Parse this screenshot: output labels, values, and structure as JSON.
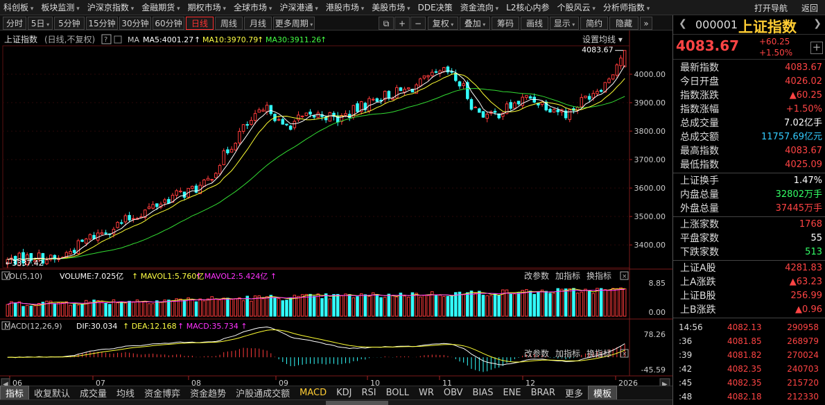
{
  "menu": {
    "items": [
      {
        "label": "科创板",
        "dd": true
      },
      {
        "label": "板块监测",
        "dd": true
      },
      {
        "label": "沪深京指数",
        "dd": true
      },
      {
        "label": "金融期货",
        "dd": true
      },
      {
        "label": "期权市场",
        "dd": true
      },
      {
        "label": "全球市场",
        "dd": true
      },
      {
        "label": "沪深港通",
        "dd": true
      },
      {
        "label": "港股市场",
        "dd": true
      },
      {
        "label": "美股市场",
        "dd": true
      },
      {
        "label": "DDE决策",
        "dd": false
      },
      {
        "label": "资金流向",
        "dd": true
      },
      {
        "label": "L2核心内参",
        "dd": false
      },
      {
        "label": "个股风云",
        "dd": true
      },
      {
        "label": "分析师指数",
        "dd": true
      }
    ],
    "right": [
      "打开导航",
      "返回"
    ]
  },
  "toolbar": {
    "periods": [
      "分时",
      "5日",
      "5分钟",
      "15分钟",
      "30分钟",
      "60分钟",
      "日线",
      "周线",
      "月线",
      "更多周期"
    ],
    "active_period": "日线",
    "tools": [
      "复权",
      "叠加",
      "筹码",
      "画线",
      "显示",
      "简约",
      "隐藏"
    ],
    "icons": [
      "⧉",
      "+",
      "−"
    ]
  },
  "chart": {
    "title": "上证指数",
    "subtitle": "(日线,不复权)",
    "help": "?",
    "ma_label": "MA",
    "ma5": "MA5:4001.27",
    "ma10": "MA10:3970.79",
    "ma30": "MA30:3911.26",
    "arrow": "↑",
    "settings": "设置均线 ▾",
    "price_labels": [
      "4000.00",
      "3900.00",
      "3800.00",
      "3700.00",
      "3600.00",
      "3500.00",
      "3400.00"
    ],
    "high_marker": "4083.67",
    "low_marker": "3337.42",
    "vol_title": "VOL(5,10)",
    "vol_val": "VOLUME:7.025亿",
    "vol_mavol1": "MAVOL1:5.760亿",
    "vol_mavol2": "MAVOL2:5.424亿",
    "vol_labels": [
      "8.85",
      "0.00"
    ],
    "macd_title": "MACD(12,26,9)",
    "macd_dif": "DIF:30.034",
    "macd_dea": "DEA:12.168",
    "macd_val": "MACD:35.734",
    "macd_labels": [
      "78.26",
      "-45.59"
    ],
    "actions": [
      "改参数",
      "加指标",
      "换指标"
    ],
    "months": [
      "06",
      "07",
      "08",
      "09",
      "10",
      "11",
      "12",
      "2026"
    ]
  },
  "chart_data": {
    "type": "candlestick",
    "ylim": [
      3320,
      4100
    ],
    "start": 3335,
    "end": 4083.67,
    "n": 158,
    "waypoints": [
      [
        0,
        3345
      ],
      [
        10,
        3360
      ],
      [
        18,
        3345
      ],
      [
        20,
        3360
      ],
      [
        30,
        3425
      ],
      [
        40,
        3470
      ],
      [
        50,
        3520
      ],
      [
        60,
        3570
      ],
      [
        65,
        3585
      ],
      [
        72,
        3610
      ],
      [
        78,
        3700
      ],
      [
        85,
        3800
      ],
      [
        92,
        3860
      ],
      [
        96,
        3880
      ],
      [
        100,
        3810
      ],
      [
        106,
        3840
      ],
      [
        115,
        3860
      ],
      [
        120,
        3840
      ],
      [
        128,
        3880
      ],
      [
        135,
        3920
      ],
      [
        140,
        3930
      ],
      [
        146,
        3945
      ],
      [
        154,
        3985
      ],
      [
        160,
        4010
      ],
      [
        166,
        3955
      ],
      [
        170,
        3880
      ],
      [
        176,
        3850
      ],
      [
        184,
        3890
      ],
      [
        190,
        3920
      ],
      [
        197,
        3890
      ],
      [
        204,
        3860
      ],
      [
        212,
        3930
      ],
      [
        218,
        3970
      ],
      [
        225,
        4083.67
      ]
    ],
    "vol_max": 8.85,
    "macd_range": [
      -45.59,
      78.26
    ]
  },
  "side": {
    "code": "000001",
    "name": "上证指数",
    "price": "4083.67",
    "change": "+60.25",
    "pct": "+1.50%",
    "rows1": [
      [
        "最新指数",
        "4083.67",
        "r"
      ],
      [
        "今日开盘",
        "4026.02",
        "r"
      ],
      [
        "指数涨跌",
        "▲60.25",
        "r"
      ],
      [
        "指数涨幅",
        "+1.50%",
        "r"
      ],
      [
        "总成交量",
        "7.02亿手",
        "w"
      ],
      [
        "总成交额",
        "11757.69亿元",
        "c"
      ],
      [
        "最高指数",
        "4083.67",
        "r"
      ],
      [
        "最低指数",
        "4025.09",
        "r"
      ]
    ],
    "rows2": [
      [
        "上证换手",
        "1.47%",
        "w"
      ],
      [
        "内盘总量",
        "32802万手",
        "g"
      ],
      [
        "外盘总量",
        "37445万手",
        "r"
      ]
    ],
    "rows3": [
      [
        "上涨家数",
        "1768",
        "r"
      ],
      [
        "平盘家数",
        "55",
        "w"
      ],
      [
        "下跌家数",
        "513",
        "g"
      ]
    ],
    "rows4": [
      [
        "上证A股",
        "4281.83",
        "r"
      ],
      [
        "上A涨跌",
        "▲63.23",
        "r"
      ],
      [
        "上证B股",
        "256.99",
        "r"
      ],
      [
        "上B涨跌",
        "▲0.96",
        "r"
      ]
    ],
    "ticks": [
      [
        "14:56",
        "4082.13",
        "290958"
      ],
      [
        ":36",
        "4081.85",
        "268979"
      ],
      [
        ":39",
        "4081.82",
        "270024"
      ],
      [
        ":42",
        "4082.35",
        "240703"
      ],
      [
        ":45",
        "4082.35",
        "215720"
      ],
      [
        ":48",
        "4082.18",
        "212330"
      ],
      [
        ":51",
        "4082.30",
        "170302"
      ]
    ]
  },
  "bottom": {
    "items": [
      "指标",
      "收复默认",
      "成交量",
      "均线",
      "资金博弈",
      "资金趋势",
      "沪股通成交额",
      "MACD",
      "KDJ",
      "RSI",
      "BOLL",
      "WR",
      "OBV",
      "BIAS",
      "ENE",
      "BRAR",
      "更多",
      "模板"
    ]
  }
}
